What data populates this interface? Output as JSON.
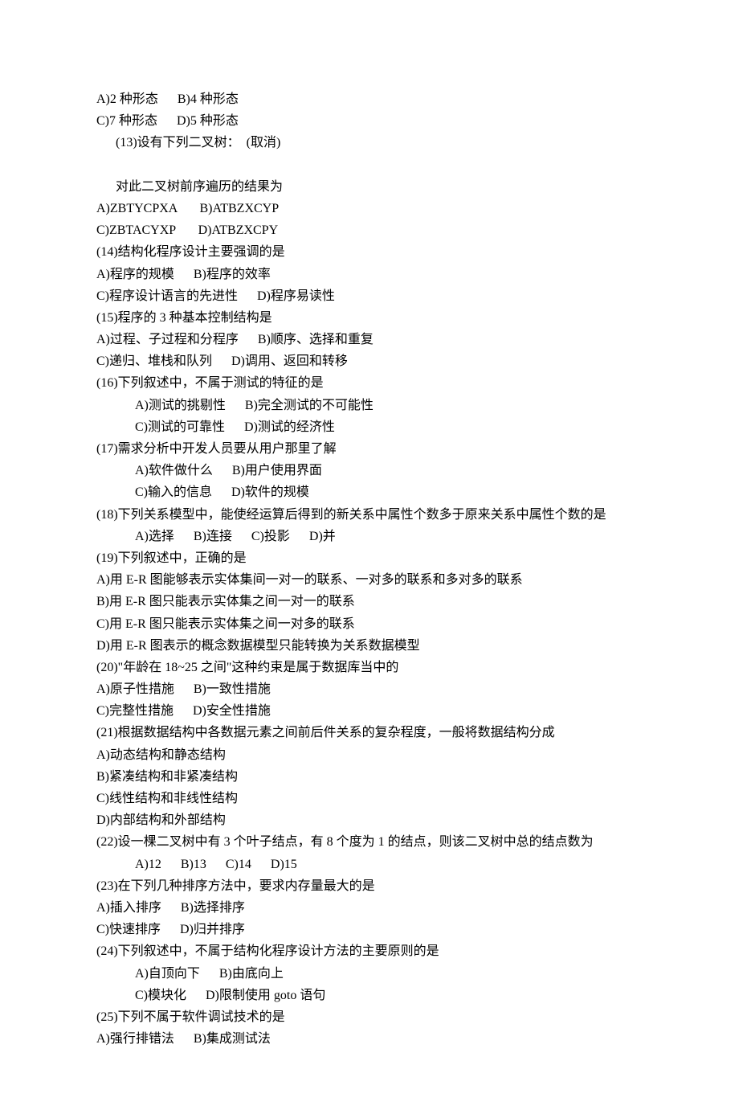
{
  "lines": [
    {
      "cls": "",
      "t": "A)2 种形态      B)4 种形态"
    },
    {
      "cls": "",
      "t": "C)7 种形态      D)5 种形态"
    },
    {
      "cls": "indent1",
      "t": "(13)设有下列二叉树：  (取消)"
    },
    {
      "cls": "",
      "t": " "
    },
    {
      "cls": "indent1",
      "t": "对此二叉树前序遍历的结果为"
    },
    {
      "cls": "",
      "t": "A)ZBTYCPXA       B)ATBZXCYP"
    },
    {
      "cls": "",
      "t": "C)ZBTACYXP       D)ATBZXCPY"
    },
    {
      "cls": "",
      "t": "(14)结构化程序设计主要强调的是"
    },
    {
      "cls": "",
      "t": "A)程序的规模      B)程序的效率"
    },
    {
      "cls": "",
      "t": "C)程序设计语言的先进性      D)程序易读性"
    },
    {
      "cls": "",
      "t": "(15)程序的 3 种基本控制结构是"
    },
    {
      "cls": "",
      "t": "A)过程、子过程和分程序      B)顺序、选择和重复"
    },
    {
      "cls": "",
      "t": "C)递归、堆栈和队列      D)调用、返回和转移"
    },
    {
      "cls": "",
      "t": "(16)下列叙述中，不属于测试的特征的是"
    },
    {
      "cls": "indent2",
      "t": "A)测试的挑剔性      B)完全测试的不可能性"
    },
    {
      "cls": "indent2",
      "t": "C)测试的可靠性      D)测试的经济性"
    },
    {
      "cls": "",
      "t": "(17)需求分析中开发人员要从用户那里了解"
    },
    {
      "cls": "indent2",
      "t": "A)软件做什么      B)用户使用界面"
    },
    {
      "cls": "indent2",
      "t": "C)输入的信息      D)软件的规模"
    },
    {
      "cls": "",
      "t": "(18)下列关系模型中，能使经运算后得到的新关系中属性个数多于原来关系中属性个数的是"
    },
    {
      "cls": "indent2",
      "t": "A)选择      B)连接      C)投影      D)并"
    },
    {
      "cls": "",
      "t": "(19)下列叙述中，正确的是"
    },
    {
      "cls": "",
      "t": "A)用 E-R 图能够表示实体集间一对一的联系、一对多的联系和多对多的联系"
    },
    {
      "cls": "",
      "t": "B)用 E-R 图只能表示实体集之间一对一的联系"
    },
    {
      "cls": "",
      "t": "C)用 E-R 图只能表示实体集之间一对多的联系"
    },
    {
      "cls": "",
      "t": "D)用 E-R 图表示的概念数据模型只能转换为关系数据模型"
    },
    {
      "cls": "",
      "t": "(20)\"年龄在 18~25 之间\"这种约束是属于数据库当中的"
    },
    {
      "cls": "",
      "t": "A)原子性措施      B)一致性措施"
    },
    {
      "cls": "",
      "t": "C)完整性措施      D)安全性措施"
    },
    {
      "cls": "",
      "t": "(21)根据数据结构中各数据元素之间前后件关系的复杂程度，一般将数据结构分成"
    },
    {
      "cls": "",
      "t": "A)动态结构和静态结构"
    },
    {
      "cls": "",
      "t": "B)紧凑结构和非紧凑结构"
    },
    {
      "cls": "",
      "t": "C)线性结构和非线性结构"
    },
    {
      "cls": "",
      "t": "D)内部结构和外部结构"
    },
    {
      "cls": "",
      "t": "(22)设一棵二叉树中有 3 个叶子结点，有 8 个度为 1 的结点，则该二叉树中总的结点数为"
    },
    {
      "cls": "indent2",
      "t": "A)12      B)13      C)14      D)15"
    },
    {
      "cls": "",
      "t": "(23)在下列几种排序方法中，要求内存量最大的是"
    },
    {
      "cls": "",
      "t": "A)插入排序      B)选择排序"
    },
    {
      "cls": "",
      "t": "C)快速排序      D)归并排序"
    },
    {
      "cls": "",
      "t": "(24)下列叙述中，不属于结构化程序设计方法的主要原则的是"
    },
    {
      "cls": "indent2",
      "t": "A)自顶向下      B)由底向上"
    },
    {
      "cls": "indent2",
      "t": "C)模块化      D)限制使用 goto 语句"
    },
    {
      "cls": "",
      "t": "(25)下列不属于软件调试技术的是"
    },
    {
      "cls": "",
      "t": "A)强行排错法      B)集成测试法"
    }
  ]
}
